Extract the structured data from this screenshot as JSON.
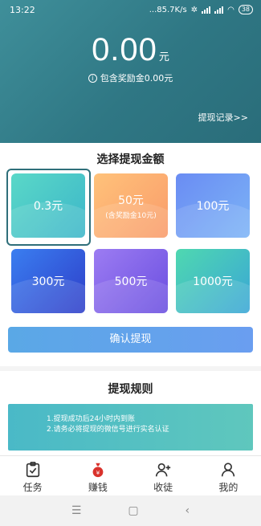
{
  "status_bar": {
    "time": "13:22",
    "network_speed": "...85.7K/s",
    "battery": "38"
  },
  "header": {
    "balance": "0.00",
    "balance_unit": "元",
    "bonus_text": "包含奖励金0.00元",
    "records_link": "提现记录>>"
  },
  "withdraw": {
    "title": "选择提现金额",
    "options": [
      {
        "label": "0.3元",
        "sub": "",
        "selected": true
      },
      {
        "label": "50元",
        "sub": "(含奖励金10元)",
        "selected": false
      },
      {
        "label": "100元",
        "sub": "",
        "selected": false
      },
      {
        "label": "300元",
        "sub": "",
        "selected": false
      },
      {
        "label": "500元",
        "sub": "",
        "selected": false
      },
      {
        "label": "1000元",
        "sub": "",
        "selected": false
      }
    ],
    "confirm_label": "确认提现"
  },
  "rules": {
    "title": "提现规则",
    "lines": [
      "1.提现成功后24小时内到账",
      "2.请务必将提现的微信号进行实名认证"
    ]
  },
  "tabbar": {
    "items": [
      {
        "label": "任务",
        "icon": "task-clipboard-icon"
      },
      {
        "label": "赚钱",
        "icon": "money-bag-icon"
      },
      {
        "label": "收徒",
        "icon": "add-user-icon"
      },
      {
        "label": "我的",
        "icon": "user-icon"
      }
    ]
  },
  "navbar": {
    "menu": "☰",
    "home": "▢",
    "back": "‹"
  },
  "colors": {
    "header": "#2f7784",
    "accent_red": "#d9322c",
    "confirm": "#5aa8e6"
  }
}
